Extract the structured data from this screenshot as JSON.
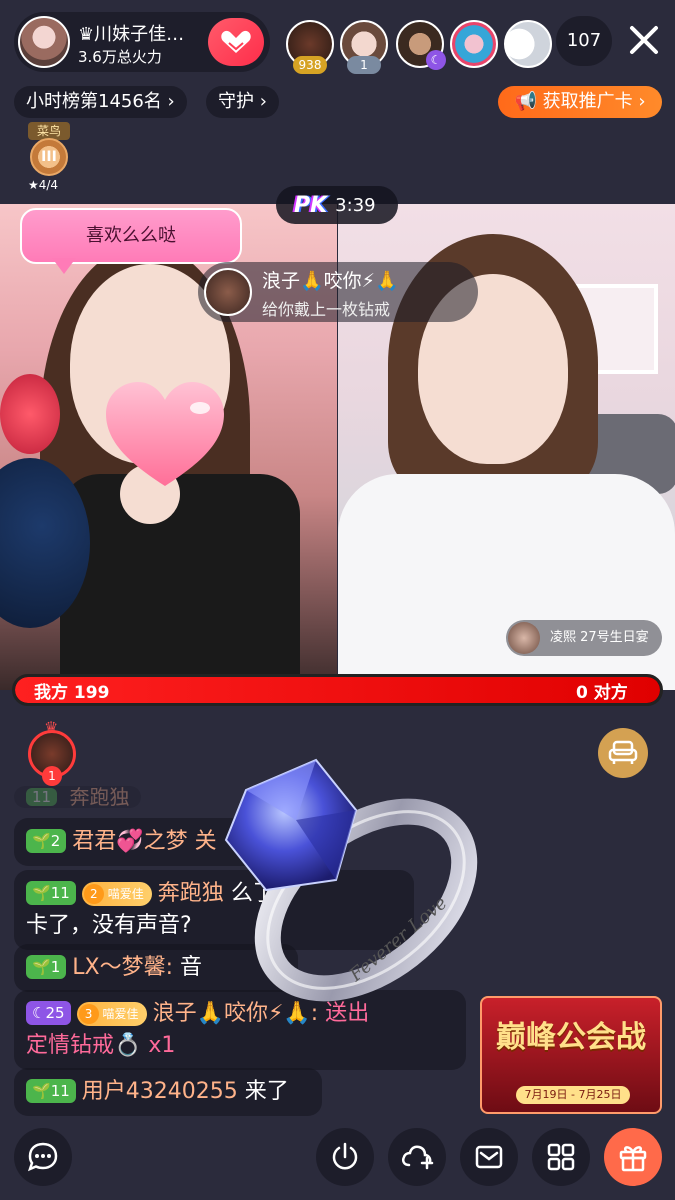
{
  "header": {
    "host_name": "♛川妹子佳…",
    "host_subtitle": "3.6万总火力",
    "viewers": [
      {
        "badge": "938"
      },
      {
        "badge": "1"
      },
      {
        "badge": ""
      },
      {
        "badge": ""
      },
      {
        "badge": ""
      }
    ],
    "viewer_count": "107"
  },
  "ranking": {
    "rank_label": "小时榜第1456名 ›",
    "guard_label": "守护 ›",
    "promo_label": "📢 获取推广卡 ›"
  },
  "medal": {
    "label": "菜鸟",
    "tier": "III",
    "progress": "★4/4"
  },
  "pk": {
    "logo": "PK",
    "time": "3:39",
    "left_score_label": "我方 199",
    "right_score_label": "0 对方",
    "left_score": 199,
    "right_score": 0
  },
  "bubble": {
    "text": "喜欢么么哒"
  },
  "gift_toast": {
    "title": "浪子🙏咬你⚡🙏",
    "subtitle": "给你戴上一枚钻戒"
  },
  "birthday_tag": {
    "text": "凌熙 27号生日宴"
  },
  "top_fan": {
    "rank": "1"
  },
  "chat": [
    {
      "level": "2",
      "name": "君君💞之梦",
      "message": "关"
    },
    {
      "level": "11",
      "fan_level": "2",
      "fan_badge": "喵爱佳",
      "name": "奔跑独",
      "message": "么了",
      "message2": "卡了，没有声音?"
    },
    {
      "level": "1",
      "name": "LX～梦馨:",
      "message": "音"
    },
    {
      "level": "25",
      "fan_level": "3",
      "fan_badge": "喵爱佳",
      "name": "浪子🙏咬你⚡🙏:",
      "message": "送出",
      "message2": "定情钻戒💍 x1"
    },
    {
      "level": "11",
      "name": "用户43240255",
      "message": "来了"
    }
  ],
  "event_banner": {
    "title": "巅峰公会战",
    "dates": "7月19日 - 7月25日"
  },
  "ring_engraving": "Feverer Love",
  "colors": {
    "accent_red": "#ff2020",
    "promo_orange": "#ff6a1a",
    "chat_name": "#ffb38a"
  }
}
